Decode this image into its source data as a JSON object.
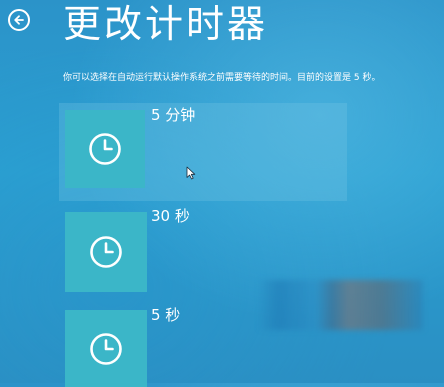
{
  "header": {
    "back_icon": "back-arrow-icon",
    "title": "更改计时器"
  },
  "description": "你可以选择在自动运行默认操作系统之前需要等待的时间。目前的设置是 5 秒。",
  "options": [
    {
      "label": "5 分钟",
      "icon": "clock-icon",
      "selected": true
    },
    {
      "label": "30 秒",
      "icon": "clock-icon",
      "selected": false
    },
    {
      "label": "5 秒",
      "icon": "clock-icon",
      "selected": false
    }
  ],
  "colors": {
    "background": "#2a9fd1",
    "tile": "#3bb6c8",
    "text": "#ffffff"
  }
}
